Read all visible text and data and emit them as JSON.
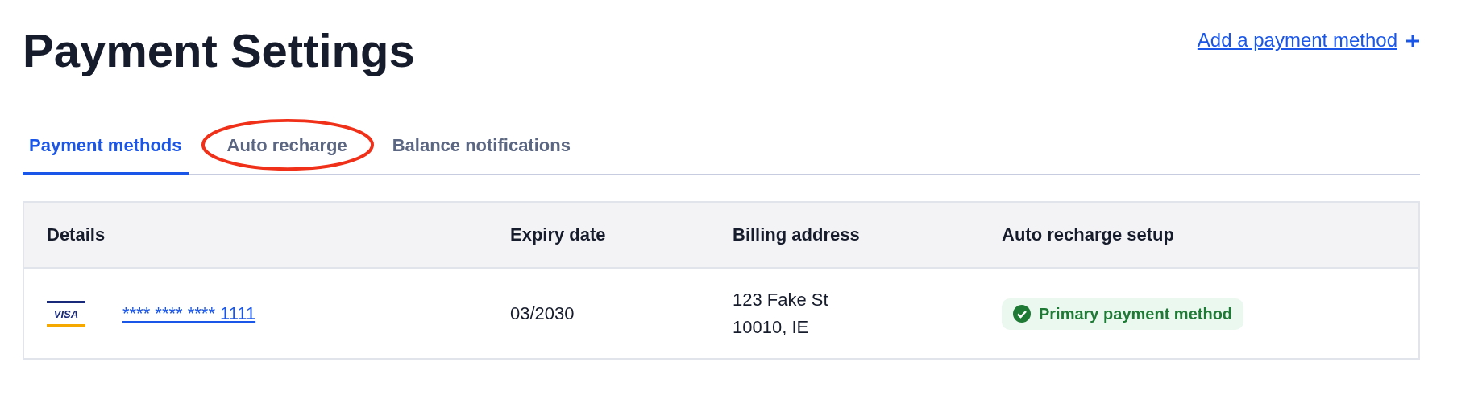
{
  "title": "Payment Settings",
  "add_link": {
    "label": "Add a payment method"
  },
  "tabs": [
    {
      "label": "Payment methods",
      "selected": true,
      "circled": false
    },
    {
      "label": "Auto recharge",
      "selected": false,
      "circled": true
    },
    {
      "label": "Balance notifications",
      "selected": false,
      "circled": false
    }
  ],
  "table": {
    "columns": [
      "Details",
      "Expiry date",
      "Billing address",
      "Auto recharge setup"
    ],
    "rows": [
      {
        "brand": "VISA",
        "card_number": "**** **** **** 1111",
        "expiry": "03/2030",
        "address": [
          "123 Fake St",
          "10010, IE"
        ],
        "status": "Primary payment method"
      }
    ]
  }
}
